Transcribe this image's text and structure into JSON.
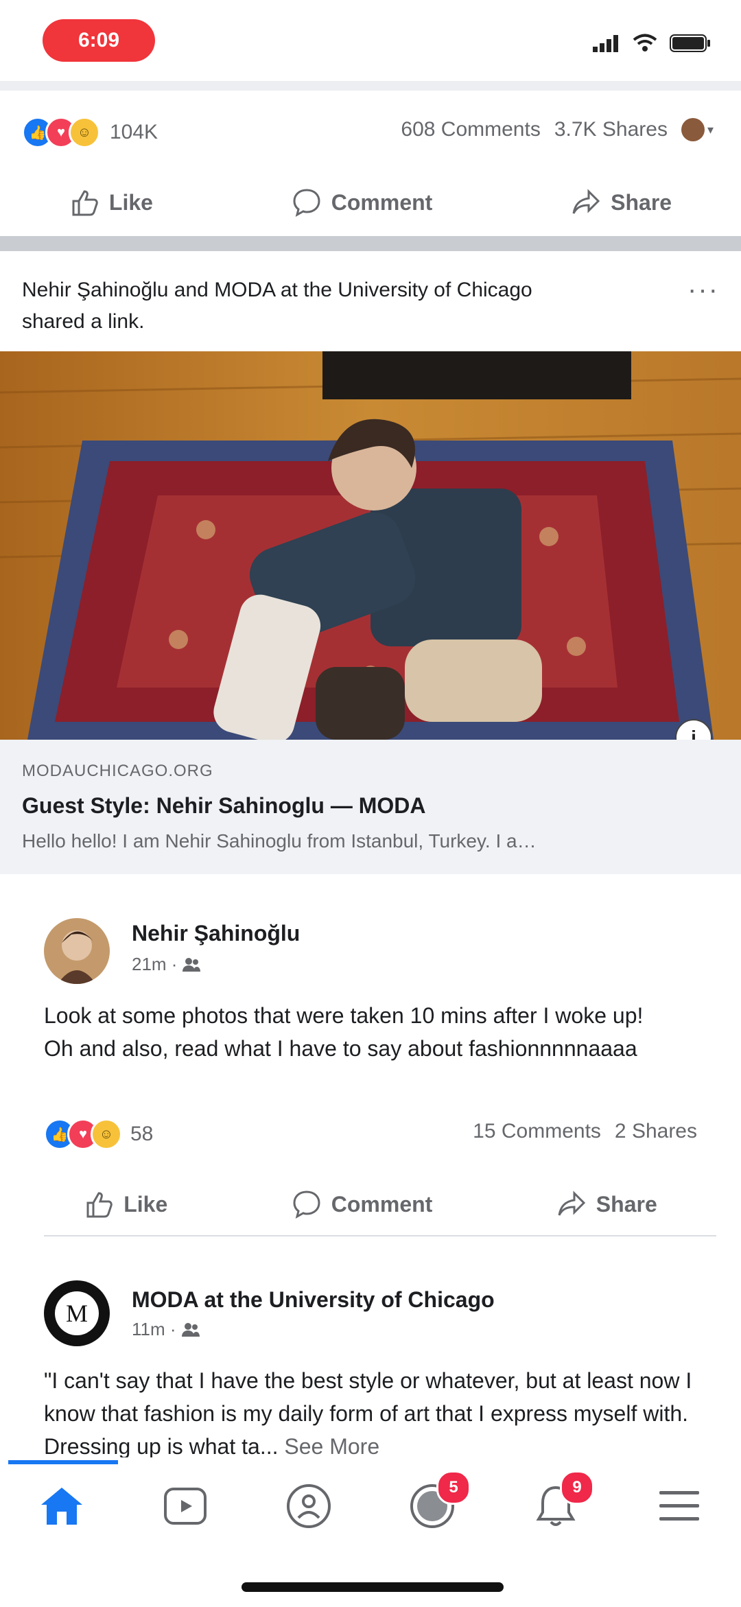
{
  "status_bar": {
    "time": "6:09"
  },
  "top_post": {
    "reaction_count": "104K",
    "comments": "608 Comments",
    "shares": "3.7K Shares",
    "actions": {
      "like": "Like",
      "comment": "Comment",
      "share": "Share"
    }
  },
  "shared_link": {
    "header": "Nehir Şahinoğlu and MODA at the University of Chicago shared a link.",
    "more": "···",
    "domain": "MODAUCHICAGO.ORG",
    "title": "Guest Style: Nehir Sahinoglu — MODA",
    "description": "Hello hello! I am Nehir Sahinoglu from Istanbul, Turkey. I a…",
    "info": "i"
  },
  "post1": {
    "author": "Nehir Şahinoğlu",
    "time": "21m ·",
    "text": "Look at some photos that were taken 10 mins after I woke up! Oh and also, read what I have to say about fashionnnnnaaaa",
    "reaction_count": "58",
    "comments": "15 Comments",
    "shares": "2 Shares",
    "actions": {
      "like": "Like",
      "comment": "Comment",
      "share": "Share"
    }
  },
  "post2": {
    "author": "MODA at the University of Chicago",
    "time": "11m ·",
    "text": "\"I can't say that I have the best style or whatever, but at least now I know that fashion is my daily form of art that I express myself with. Dressing up is what ta...",
    "see_more": "See More"
  },
  "nav": {
    "items": [
      {
        "icon": "home-icon",
        "badge": ""
      },
      {
        "icon": "watch-icon",
        "badge": ""
      },
      {
        "icon": "groups-icon",
        "badge": ""
      },
      {
        "icon": "profile-icon",
        "badge": "5"
      },
      {
        "icon": "notifications-icon",
        "badge": "9"
      },
      {
        "icon": "menu-icon",
        "badge": ""
      }
    ]
  },
  "colors": {
    "accent": "#1877f2",
    "badge": "#f02849",
    "time_pill": "#f0353b"
  }
}
